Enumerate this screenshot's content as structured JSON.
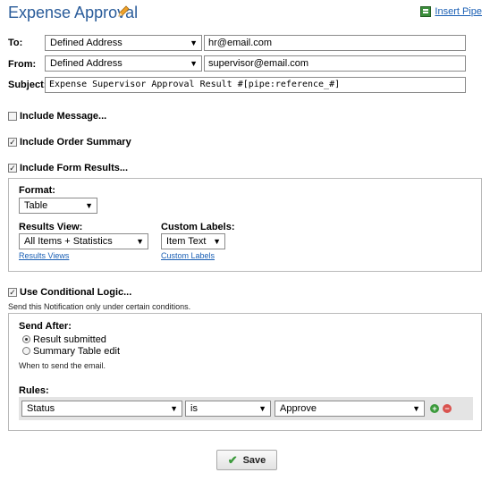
{
  "header": {
    "title": "Expense Approval",
    "insert_pipe": "Insert Pipe",
    "icons": {
      "edit": "pencil-icon",
      "pipe": "pipe-icon"
    }
  },
  "fields": {
    "to": {
      "label": "To:",
      "type_select": "Defined Address",
      "address": "hr@email.com"
    },
    "from": {
      "label": "From:",
      "type_select": "Defined Address",
      "address": "supervisor@email.com"
    },
    "subject": {
      "label": "Subject:",
      "value": "Expense Supervisor Approval Result #[pipe:reference_#]"
    }
  },
  "include_message": {
    "label": "Include Message...",
    "checked": false
  },
  "include_order_summary": {
    "label": "Include Order Summary",
    "checked": true
  },
  "include_form_results": {
    "label": "Include Form Results...",
    "checked": true,
    "format": {
      "label": "Format:",
      "value": "Table"
    },
    "results_view": {
      "label": "Results View:",
      "value": "All Items + Statistics",
      "link": "Results Views"
    },
    "custom_labels": {
      "label": "Custom Labels:",
      "value": "Item Text",
      "link": "Custom Labels"
    }
  },
  "conditional_logic": {
    "label": "Use Conditional Logic...",
    "checked": true,
    "description": "Send this Notification only under certain conditions.",
    "send_after": {
      "label": "Send After:",
      "options": [
        {
          "label": "Result submitted",
          "selected": true
        },
        {
          "label": "Summary Table edit",
          "selected": false
        }
      ],
      "help": "When to send the email."
    },
    "rules": {
      "label": "Rules:",
      "rows": [
        {
          "field": "Status",
          "operator": "is",
          "value": "Approve"
        }
      ]
    }
  },
  "save_button": {
    "label": "Save"
  },
  "colors": {
    "title": "#2a5c9a",
    "link": "#1a5fb4",
    "add": "#3c9a3c",
    "remove": "#d9534f"
  }
}
